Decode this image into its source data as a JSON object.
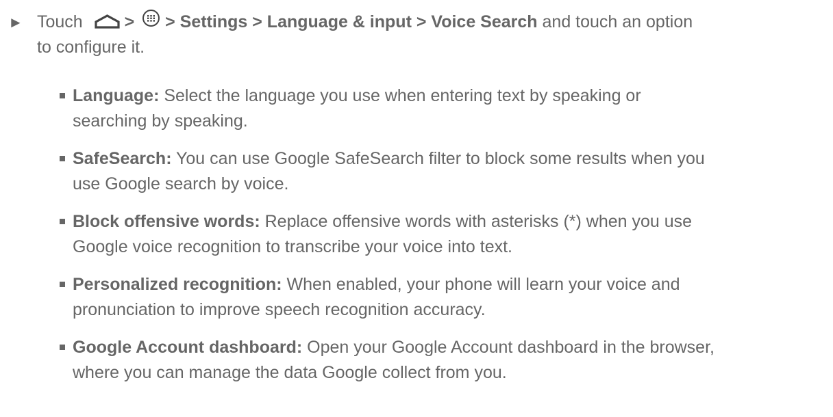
{
  "step": {
    "marker": "►",
    "prefix": "Touch",
    "sep1": ">",
    "path": "> Settings > Language & input > Voice Search",
    "suffix_line1": " and touch an option",
    "suffix_line2": "to configure it.",
    "home_icon": "home-icon",
    "apps_icon": "apps-icon"
  },
  "options": [
    {
      "term": "Language:",
      "desc_line1": " Select the language you use when entering text by speaking or",
      "desc_line2": "searching by speaking."
    },
    {
      "term": "SafeSearch:",
      "desc_line1": " You can use Google SafeSearch filter to block some results when you",
      "desc_line2": "use Google search by voice."
    },
    {
      "term": "Block offensive words:",
      "desc_line1": " Replace offensive words with asterisks (*) when you use",
      "desc_line2": "Google voice recognition to transcribe your voice into text."
    },
    {
      "term": "Personalized recognition:",
      "desc_line1": " When enabled, your phone will learn your voice and",
      "desc_line2": "pronunciation to improve speech recognition accuracy."
    },
    {
      "term": "Google Account dashboard:",
      "desc_line1": " Open your Google Account dashboard in the browser,",
      "desc_line2": "where you can manage the data Google collect from you."
    }
  ],
  "colors": {
    "text": "#666666",
    "background": "#ffffff"
  }
}
